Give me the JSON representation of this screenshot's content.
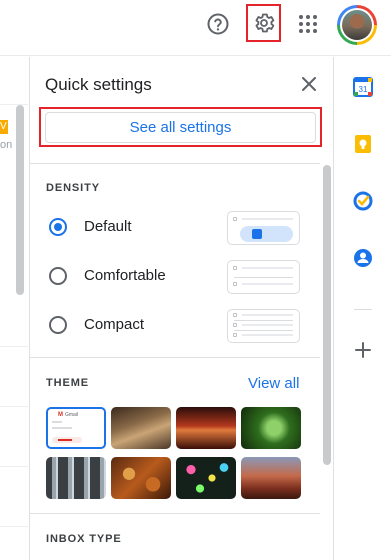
{
  "topbar": {
    "help_icon": "help-circle-icon",
    "settings_icon": "gear-icon",
    "apps_icon": "apps-grid-icon",
    "avatar_label": "account-avatar"
  },
  "mail_list": {
    "badge": "V",
    "partial_text": "on"
  },
  "quick_settings": {
    "title": "Quick settings",
    "close_icon": "close-icon",
    "see_all_label": "See all settings",
    "density": {
      "label": "DENSITY",
      "options": [
        {
          "label": "Default",
          "checked": true
        },
        {
          "label": "Comfortable",
          "checked": false
        },
        {
          "label": "Compact",
          "checked": false
        }
      ]
    },
    "theme": {
      "label": "THEME",
      "view_all": "View all",
      "mini_gmail_text": "Gmail",
      "thumbnails": [
        {
          "name": "default-gmail",
          "selected": true
        },
        {
          "name": "chess",
          "selected": false
        },
        {
          "name": "canyon",
          "selected": false
        },
        {
          "name": "caterpillar",
          "selected": false
        },
        {
          "name": "tubes",
          "selected": false
        },
        {
          "name": "leaves",
          "selected": false
        },
        {
          "name": "bokeh",
          "selected": false
        },
        {
          "name": "desert",
          "selected": false
        }
      ]
    },
    "inbox_type": {
      "label": "INBOX TYPE"
    }
  },
  "side_rail": {
    "items": [
      {
        "name": "calendar-icon",
        "text": "31",
        "color": "#1a73e8"
      },
      {
        "name": "keep-icon",
        "color": "#fbbc04"
      },
      {
        "name": "tasks-icon",
        "color": "#1a73e8"
      },
      {
        "name": "contacts-icon",
        "color": "#1a73e8"
      },
      {
        "name": "add-icon",
        "color": "#5f6368"
      }
    ]
  },
  "colors": {
    "accent": "#1a73e8",
    "highlight": "#e4232b"
  }
}
